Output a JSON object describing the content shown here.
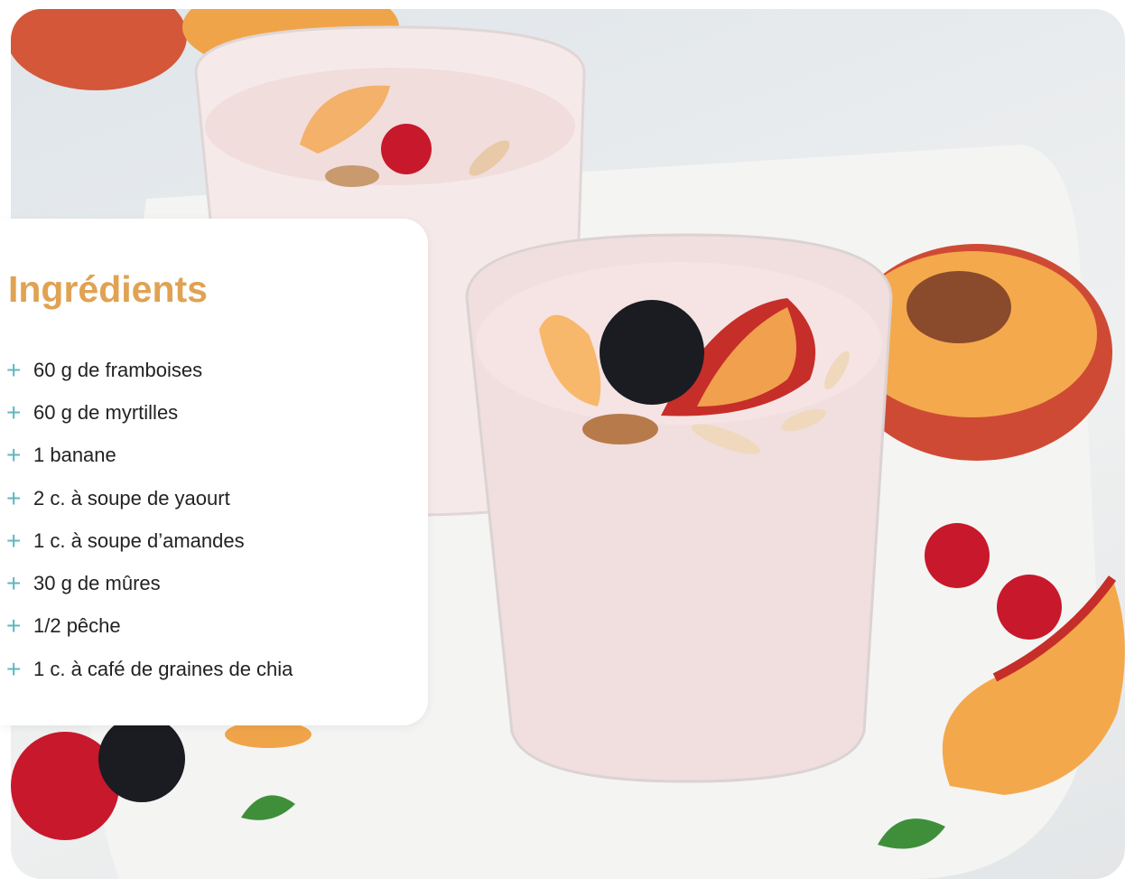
{
  "title": "Ingrédients",
  "ingredients": [
    "60 g de framboises",
    "60 g de myrtilles",
    "1 banane",
    "2 c. à soupe de yaourt",
    "1 c. à soupe d’amandes",
    "30 g de mûres",
    "1/2 pêche",
    "1 c. à café de graines de chia"
  ],
  "colors": {
    "title": "#e0a253",
    "plus": "#5fb7bd",
    "smoothie": "#f2dcdc",
    "peach": "#f5a33a",
    "peach_skin": "#c9302a",
    "raspberry": "#c8182b",
    "blackberry": "#1b1b22"
  },
  "icons": {
    "bullet": "plus-icon"
  }
}
